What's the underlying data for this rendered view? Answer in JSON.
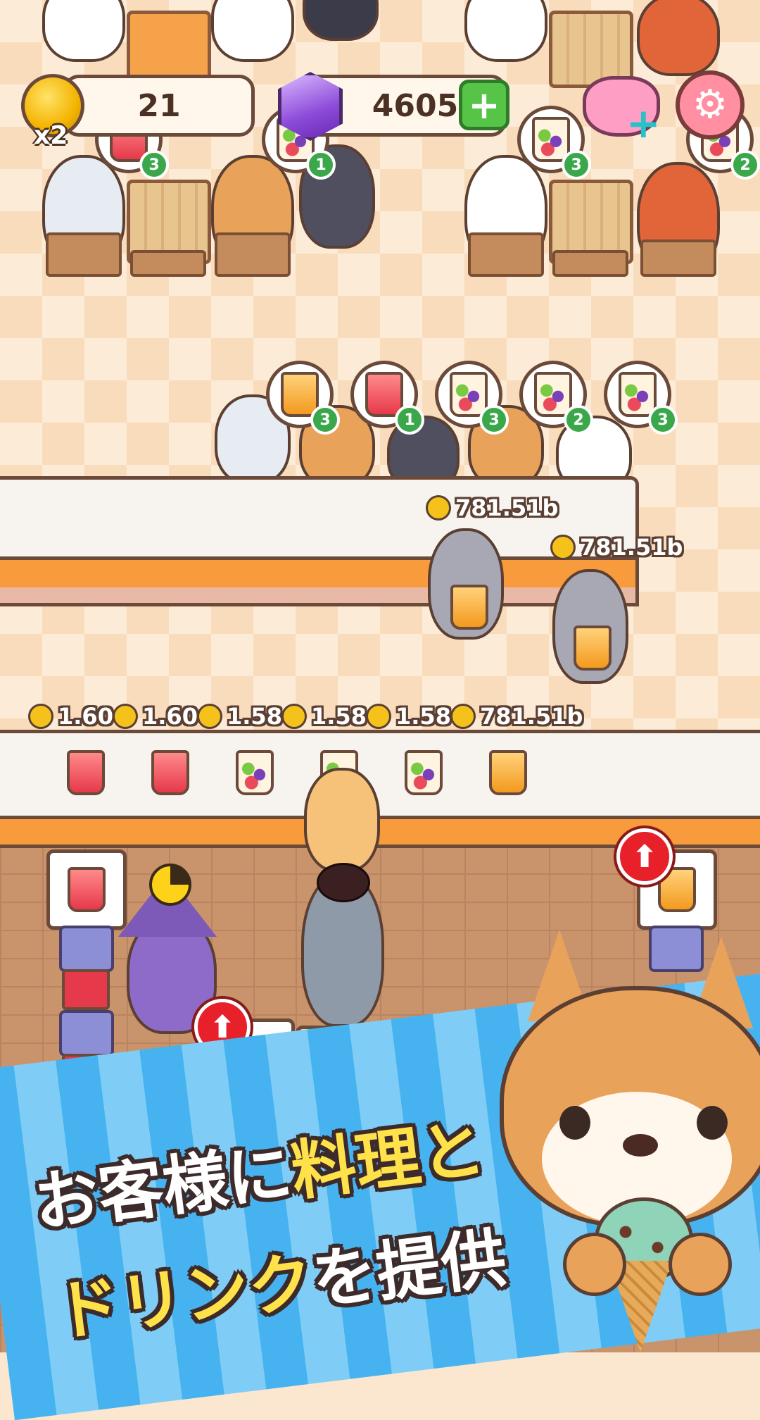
{
  "hud": {
    "paw_coins": "21",
    "multiplier": "x2",
    "gems": "4605",
    "plus_label": "+"
  },
  "orders_top": [
    {
      "drink": "fruit",
      "count": "1"
    },
    {
      "drink": "fruit",
      "count": "3"
    },
    {
      "drink": "fruit",
      "count": "2"
    },
    {
      "drink": "red",
      "count": "3"
    }
  ],
  "orders_queue": [
    {
      "drink": "orange",
      "count": "3"
    },
    {
      "drink": "red",
      "count": "1"
    },
    {
      "drink": "fruit",
      "count": "3"
    },
    {
      "drink": "fruit",
      "count": "2"
    },
    {
      "drink": "fruit",
      "count": "3"
    }
  ],
  "waiter_earnings": [
    "781.51b",
    "781.51b"
  ],
  "counter_prices": [
    "1.60",
    "1.60",
    "1.58",
    "1.58",
    "1.58",
    "781.51b"
  ],
  "counter_drinks": [
    "red",
    "red",
    "fruit",
    "fruit",
    "fruit",
    "orange"
  ],
  "banner": {
    "line1_a": "お客様に",
    "line1_b": "料理と",
    "line2_a": "ドリンク",
    "line2_b": "を提供"
  },
  "colors": {
    "accent": "#f79b3d",
    "gem": "#8c4bd8",
    "banner": "#46b3f0",
    "highlight": "#ffe24a"
  }
}
